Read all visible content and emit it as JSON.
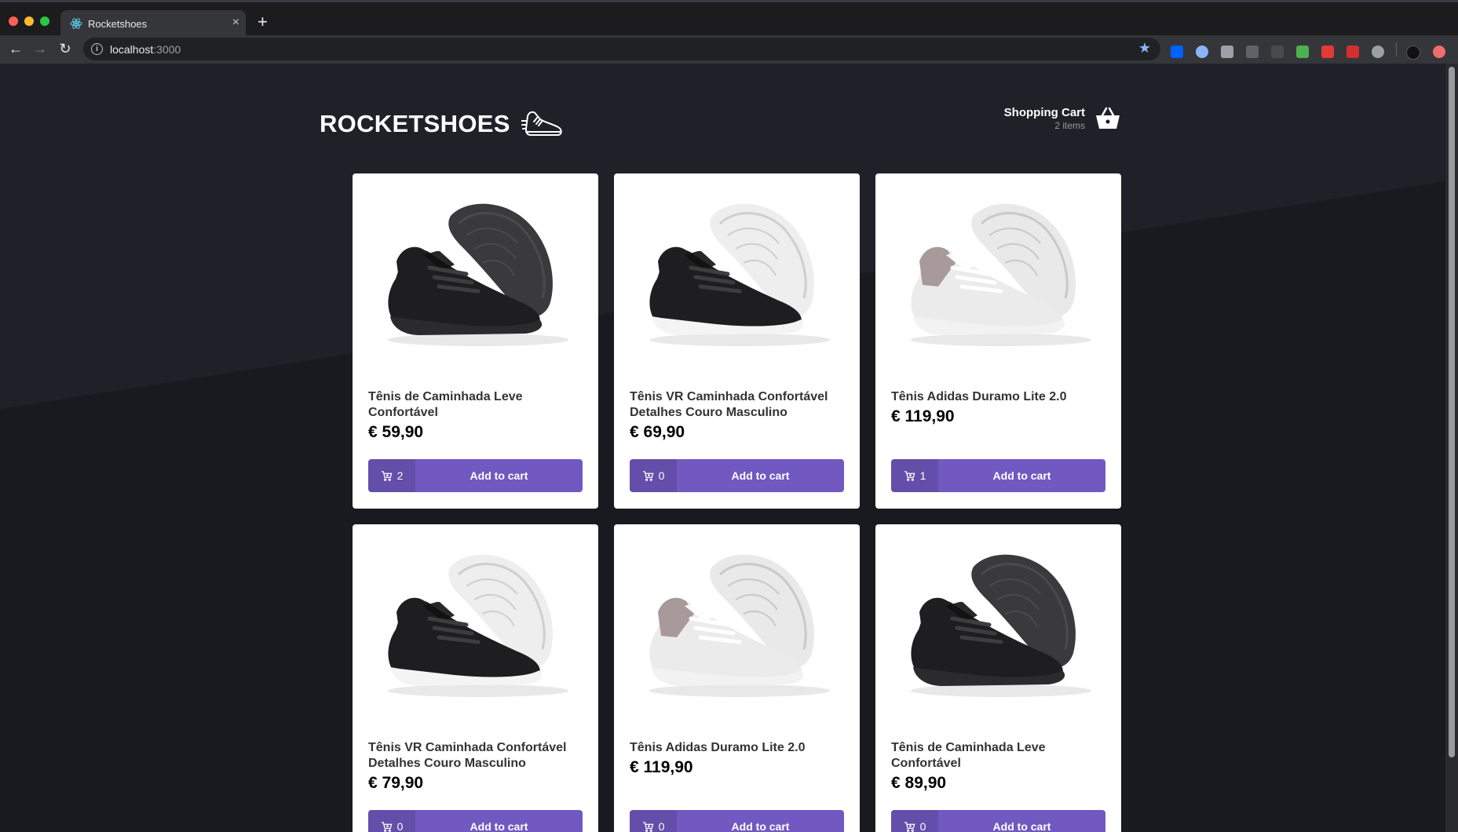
{
  "browser": {
    "tab_title": "Rocketshoes",
    "new_tab": "+",
    "close": "×",
    "url_host": "localhost",
    "url_port": ":3000",
    "info": "i"
  },
  "header": {
    "logo_text": "ROCKETSHOES",
    "cart_title": "Shopping Cart",
    "cart_count": "2 items"
  },
  "products": [
    {
      "title": "Tênis de Caminhada Leve Confortável",
      "price": "€ 59,90",
      "amount": "2",
      "button": "Add to cart",
      "style": "black"
    },
    {
      "title": "Tênis VR Caminhada Confortável Detalhes Couro Masculino",
      "price": "€ 69,90",
      "amount": "0",
      "button": "Add to cart",
      "style": "blackwhite"
    },
    {
      "title": "Tênis Adidas Duramo Lite 2.0",
      "price": "€ 119,90",
      "amount": "1",
      "button": "Add to cart",
      "style": "white"
    },
    {
      "title": "Tênis VR Caminhada Confortável Detalhes Couro Masculino",
      "price": "€ 79,90",
      "amount": "0",
      "button": "Add to cart",
      "style": "blackwhite"
    },
    {
      "title": "Tênis Adidas Duramo Lite 2.0",
      "price": "€ 119,90",
      "amount": "0",
      "button": "Add to cart",
      "style": "white"
    },
    {
      "title": "Tênis de Caminhada Leve Confortável",
      "price": "€ 89,90",
      "amount": "0",
      "button": "Add to cart",
      "style": "black"
    }
  ],
  "colors": {
    "accent": "#7159c1",
    "background": "#191920"
  }
}
